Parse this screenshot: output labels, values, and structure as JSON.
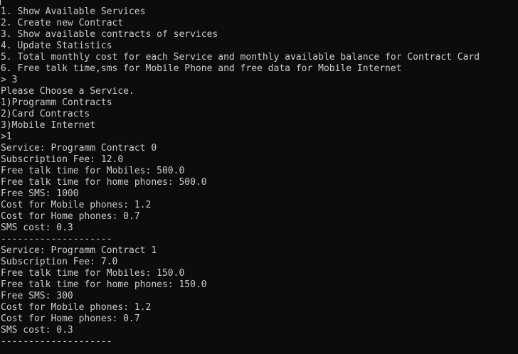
{
  "console": {
    "lines": [
      "1. Show Available Services",
      "2. Create new Contract",
      "3. Show available contracts of services",
      "4. Update Statistics",
      "5. Total monthly cost for each Service and monthly available balance for Contract Card",
      "6. Free talk time,sms for Mobile Phone and free data for Mobile Internet",
      "> 3",
      "Please Choose a Service.",
      "1)Programm Contracts",
      "2)Card Contracts",
      "3)Mobile Internet",
      ">1",
      "Service: Programm Contract 0",
      "Subscription Fee: 12.0",
      "Free talk time for Mobiles: 500.0",
      "Free talk time for home phones: 500.0",
      "Free SMS: 1000",
      "Cost for Mobile phones: 1.2",
      "Cost for Home phones: 0.7",
      "SMS cost: 0.3",
      "--------------------",
      "Service: Programm Contract 1",
      "Subscription Fee: 7.0",
      "Free talk time for Mobiles: 150.0",
      "Free talk time for home phones: 150.0",
      "Free SMS: 300",
      "Cost for Mobile phones: 1.2",
      "Cost for Home phones: 0.7",
      "SMS cost: 0.3",
      "--------------------"
    ]
  },
  "colors": {
    "background": "#0c0c0c",
    "text": "#cccccc"
  }
}
